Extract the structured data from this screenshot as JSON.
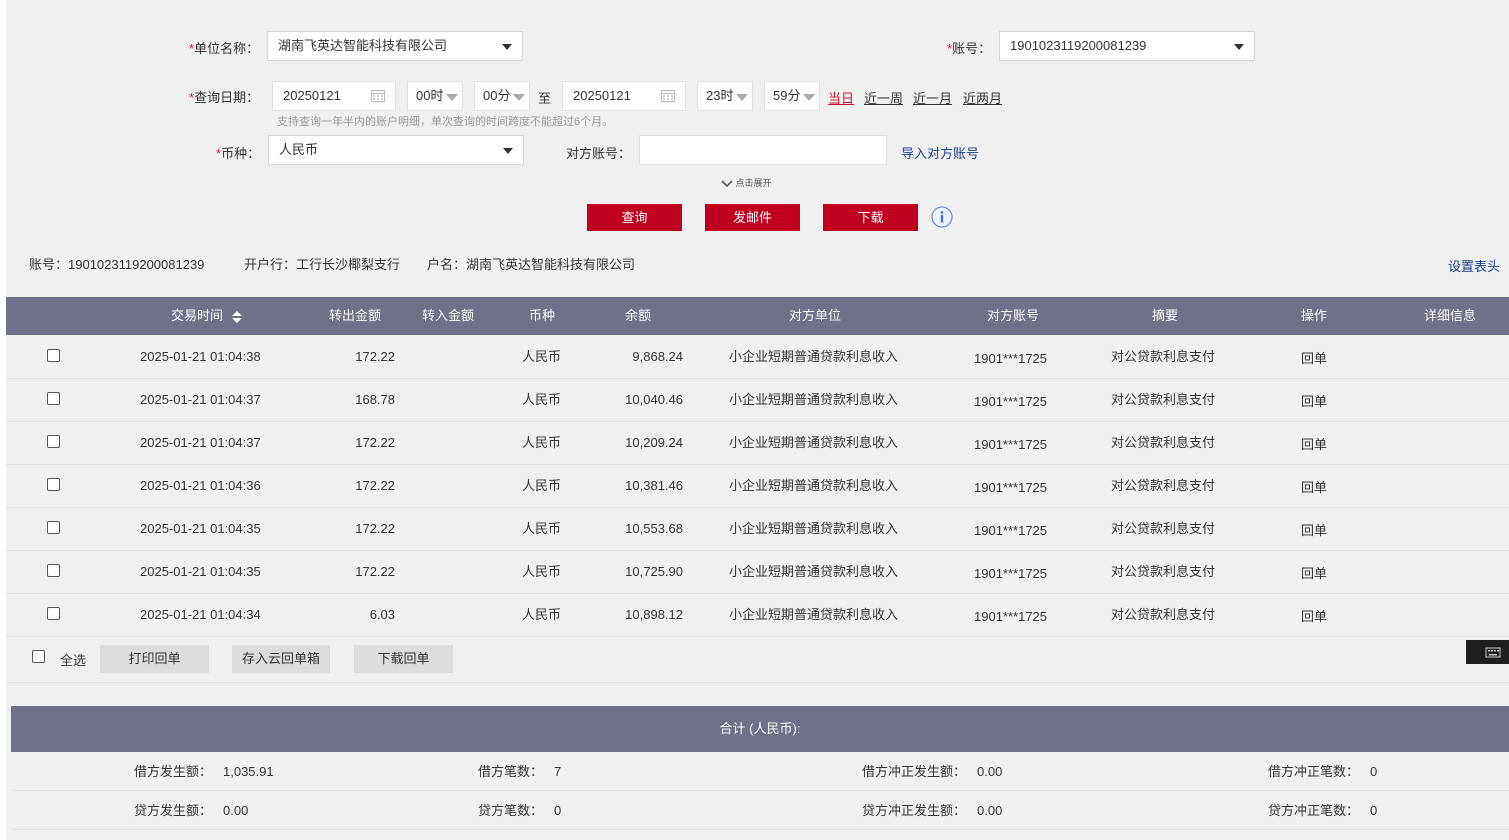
{
  "form": {
    "unit": {
      "required_mark": "*",
      "label": "单位名称：",
      "value": "湖南飞英达智能科技有限公司"
    },
    "account": {
      "required_mark": "*",
      "label": "账号：",
      "value": "1901023119200081239"
    },
    "date": {
      "required_mark": "*",
      "label": "查询日期：",
      "start_date": "20250121",
      "start_hour": "00时",
      "start_min": "00分",
      "to": "至",
      "end_date": "20250121",
      "end_hour": "23时",
      "end_min": "59分",
      "quick": [
        "当日",
        "近一周",
        "近一月",
        "近两月"
      ],
      "hint": "支持查询一年半内的账户明细，单次查询的时间跨度不能超过6个月。"
    },
    "currency": {
      "required_mark": "*",
      "label": "币种：",
      "value": "人民币"
    },
    "counter_account": {
      "label": "对方账号：",
      "value": "",
      "import_link": "导入对方账号"
    },
    "expand": "点击展开",
    "buttons": {
      "query": "查询",
      "mail": "发邮件",
      "download": "下载"
    }
  },
  "account_info": {
    "account": "账号：1901023119200081239",
    "bank": "开户行：工行长沙椰梨支行",
    "name": "户名：湖南飞英达智能科技有限公司",
    "set_header": "设置表头"
  },
  "table": {
    "headers": {
      "time": "交易时间",
      "out": "转出金额",
      "in": "转入金额",
      "currency": "币种",
      "balance": "余额",
      "party": "对方单位",
      "party_acct": "对方账号",
      "summary": "摘要",
      "op": "操作",
      "detail": "详细信息"
    },
    "rows": [
      {
        "time": "2025-01-21  01:04:38",
        "out": "172.22",
        "in": "",
        "currency": "人民币",
        "balance": "9,868.24",
        "party": "小企业短期普通贷款利息收入",
        "party_acct": "1901***1725",
        "summary": "对公贷款利息支付",
        "op": "回单",
        "detail": ""
      },
      {
        "time": "2025-01-21  01:04:37",
        "out": "168.78",
        "in": "",
        "currency": "人民币",
        "balance": "10,040.46",
        "party": "小企业短期普通贷款利息收入",
        "party_acct": "1901***1725",
        "summary": "对公贷款利息支付",
        "op": "回单",
        "detail": ""
      },
      {
        "time": "2025-01-21  01:04:37",
        "out": "172.22",
        "in": "",
        "currency": "人民币",
        "balance": "10,209.24",
        "party": "小企业短期普通贷款利息收入",
        "party_acct": "1901***1725",
        "summary": "对公贷款利息支付",
        "op": "回单",
        "detail": ""
      },
      {
        "time": "2025-01-21  01:04:36",
        "out": "172.22",
        "in": "",
        "currency": "人民币",
        "balance": "10,381.46",
        "party": "小企业短期普通贷款利息收入",
        "party_acct": "1901***1725",
        "summary": "对公贷款利息支付",
        "op": "回单",
        "detail": ""
      },
      {
        "time": "2025-01-21  01:04:35",
        "out": "172.22",
        "in": "",
        "currency": "人民币",
        "balance": "10,553.68",
        "party": "小企业短期普通贷款利息收入",
        "party_acct": "1901***1725",
        "summary": "对公贷款利息支付",
        "op": "回单",
        "detail": ""
      },
      {
        "time": "2025-01-21  01:04:35",
        "out": "172.22",
        "in": "",
        "currency": "人民币",
        "balance": "10,725.90",
        "party": "小企业短期普通贷款利息收入",
        "party_acct": "1901***1725",
        "summary": "对公贷款利息支付",
        "op": "回单",
        "detail": ""
      },
      {
        "time": "2025-01-21  01:04:34",
        "out": "6.03",
        "in": "",
        "currency": "人民币",
        "balance": "10,898.12",
        "party": "小企业短期普通贷款利息收入",
        "party_acct": "1901***1725",
        "summary": "对公贷款利息支付",
        "op": "回单",
        "detail": ""
      }
    ]
  },
  "batch": {
    "select_all": "全选",
    "print": "打印回单",
    "save_cloud": "存入云回单箱",
    "download": "下载回单"
  },
  "totals": {
    "title": "合计 (人民币):",
    "debit_amount_label": "借方发生额：",
    "debit_amount": "1,035.91",
    "debit_count_label": "借方笔数：",
    "debit_count": "7",
    "debit_rev_amount_label": "借方冲正发生额：",
    "debit_rev_amount": "0.00",
    "debit_rev_count_label": "借方冲正笔数：",
    "debit_rev_count": "0",
    "credit_amount_label": "贷方发生额：",
    "credit_amount": "0.00",
    "credit_count_label": "贷方笔数：",
    "credit_count": "0",
    "credit_rev_amount_label": "贷方冲正发生额：",
    "credit_rev_amount": "0.00",
    "credit_rev_count_label": "贷方冲正笔数：",
    "credit_rev_count": "0"
  },
  "colors": {
    "brand_red": "#c00020",
    "header_bg": "#6f7189",
    "link_blue": "#1d3f8f"
  },
  "icons": [
    "calendar-icon",
    "info-icon",
    "chevron-down-icon",
    "keyboard-icon",
    "sort-icon"
  ]
}
